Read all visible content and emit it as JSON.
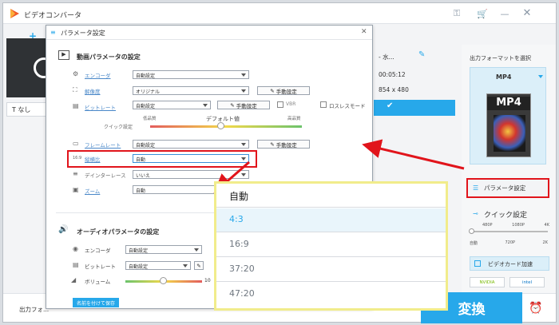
{
  "app": {
    "title": "ビデオコンバータ"
  },
  "main": {
    "preview_subtitle": "なし",
    "file_info": {
      "name": "- 水...",
      "duration": "00:05:12",
      "resolution": "854 x 480"
    },
    "output_file_label": "出力フォ..."
  },
  "dialog": {
    "title": "パラメータ設定",
    "video_section_title": "動画パラメータの設定",
    "encoder_label": "エンコーダ",
    "encoder_value": "自動設定",
    "resolution_label": "解像度",
    "resolution_value": "オリジナル",
    "resolution_manual": "手動設定",
    "bitrate_label": "ビットレート",
    "bitrate_value": "自動設定",
    "bitrate_manual": "手動設定",
    "vbr_label": "VBR",
    "lossless_label": "ロスレスモード",
    "quick_label": "クイック設定",
    "quality_low": "低品質",
    "quality_default": "デフォルト値",
    "quality_high": "高品質",
    "framerate_label": "フレームレート",
    "framerate_value": "自動設定",
    "framerate_manual": "手動設定",
    "aspect_label": "縦横比",
    "aspect_value": "自動",
    "deinterlace_label": "デインターレース",
    "deinterlace_value": "いいえ",
    "zoom_label": "ズーム",
    "zoom_value": "自動",
    "audio_section_title": "オーディオパラメータの設定",
    "audio_encoder_label": "エンコーダ",
    "audio_encoder_value": "自動設定",
    "audio_bitrate_label": "ビットレート",
    "audio_bitrate_value": "自動設定",
    "volume_label": "ボリューム",
    "volume_value": "10",
    "save_as_button": "名前を付けて保存"
  },
  "popup": {
    "options": [
      "自動",
      "4:3",
      "16:9",
      "37:20",
      "47:20"
    ],
    "selected_index": 1
  },
  "right_panel": {
    "output_format_title": "出力フォーマットを選択",
    "format_value": "MP4",
    "format_icon_text": "MP4",
    "param_button": "パラメータ設定",
    "quick_title": "クイック設定",
    "scale_top": [
      "480P",
      "1080P",
      "4K"
    ],
    "scale_bottom": [
      "自動",
      "720P",
      "2K"
    ],
    "gpu_button": "ビデオカード加速",
    "gpu_badges": [
      "NVIDIA",
      "intel"
    ]
  },
  "convert_button": "変換",
  "colors": {
    "accent": "#27a8ea",
    "highlight": "#e1141b",
    "popup_border": "#f1ec8b",
    "selected_row": "#e9f5fb"
  }
}
